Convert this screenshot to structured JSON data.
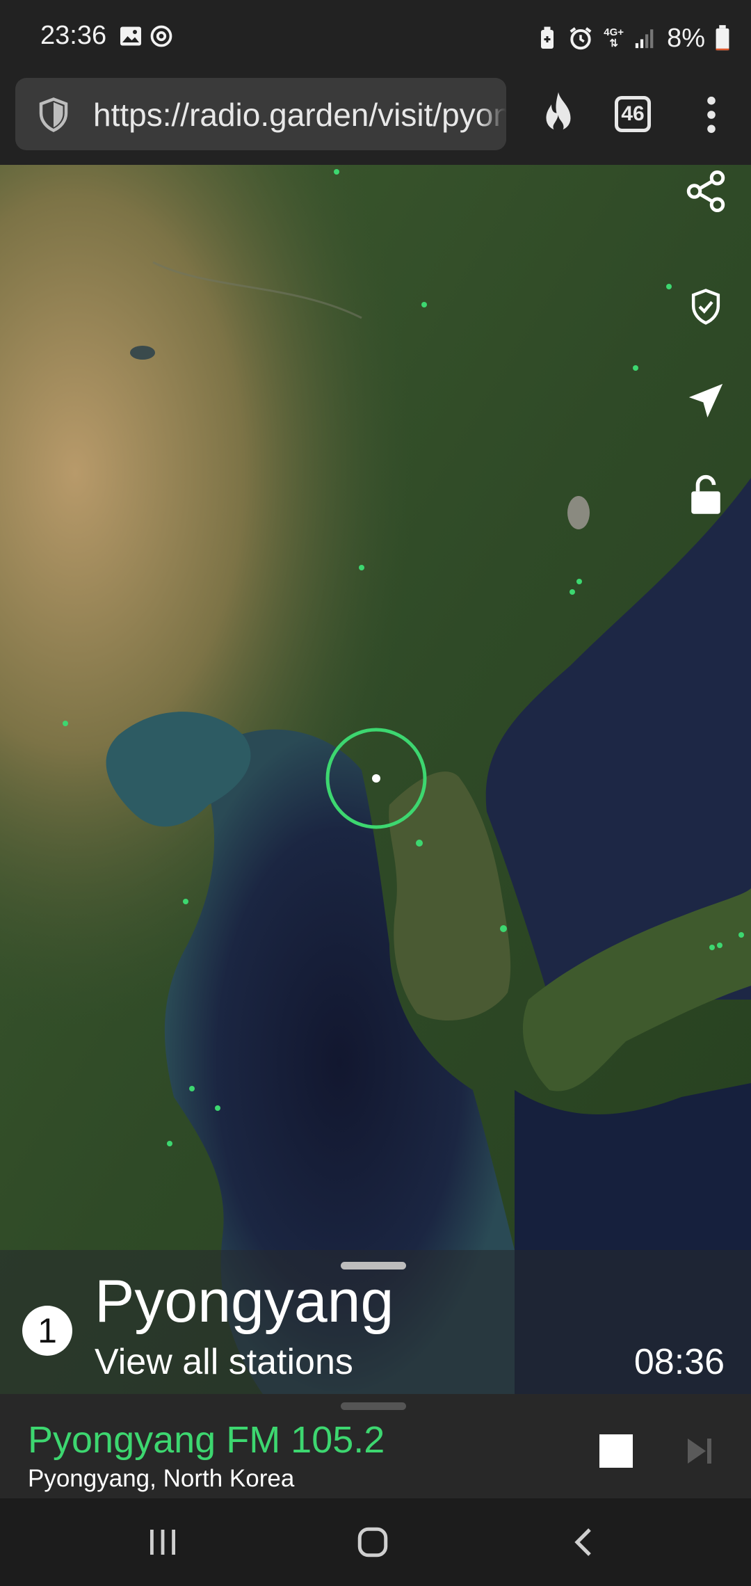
{
  "status_bar": {
    "time": "23:36",
    "icons_left": [
      "gallery-icon",
      "sync-icon"
    ],
    "icons_right": [
      "battery-saver-icon",
      "alarm-icon",
      "network-4g-icon",
      "signal-icon"
    ],
    "network_label": "4G+",
    "battery_percent": "8%",
    "battery_level": 0.08,
    "battery_color": "#e0582c"
  },
  "browser": {
    "url": "https://radio.garden/visit/pyongyang",
    "tab_count": "46",
    "icons": [
      "shield-icon",
      "fire-icon",
      "tabs-icon",
      "more-vert-icon"
    ]
  },
  "map": {
    "side_buttons": [
      "share-icon",
      "shield-check-icon",
      "navigation-icon",
      "unlock-icon"
    ],
    "accent_color": "#3dd770"
  },
  "city_panel": {
    "badge": "1",
    "city": "Pyongyang",
    "link": "View all stations",
    "local_time": "08:36"
  },
  "player": {
    "station": "Pyongyang FM 105.2",
    "location": "Pyongyang, North Korea",
    "station_color": "#3dd770",
    "controls": [
      "stop-icon",
      "skip-next-icon"
    ]
  },
  "nav_bar": {
    "buttons": [
      "recent-apps-icon",
      "home-icon",
      "back-icon"
    ]
  }
}
